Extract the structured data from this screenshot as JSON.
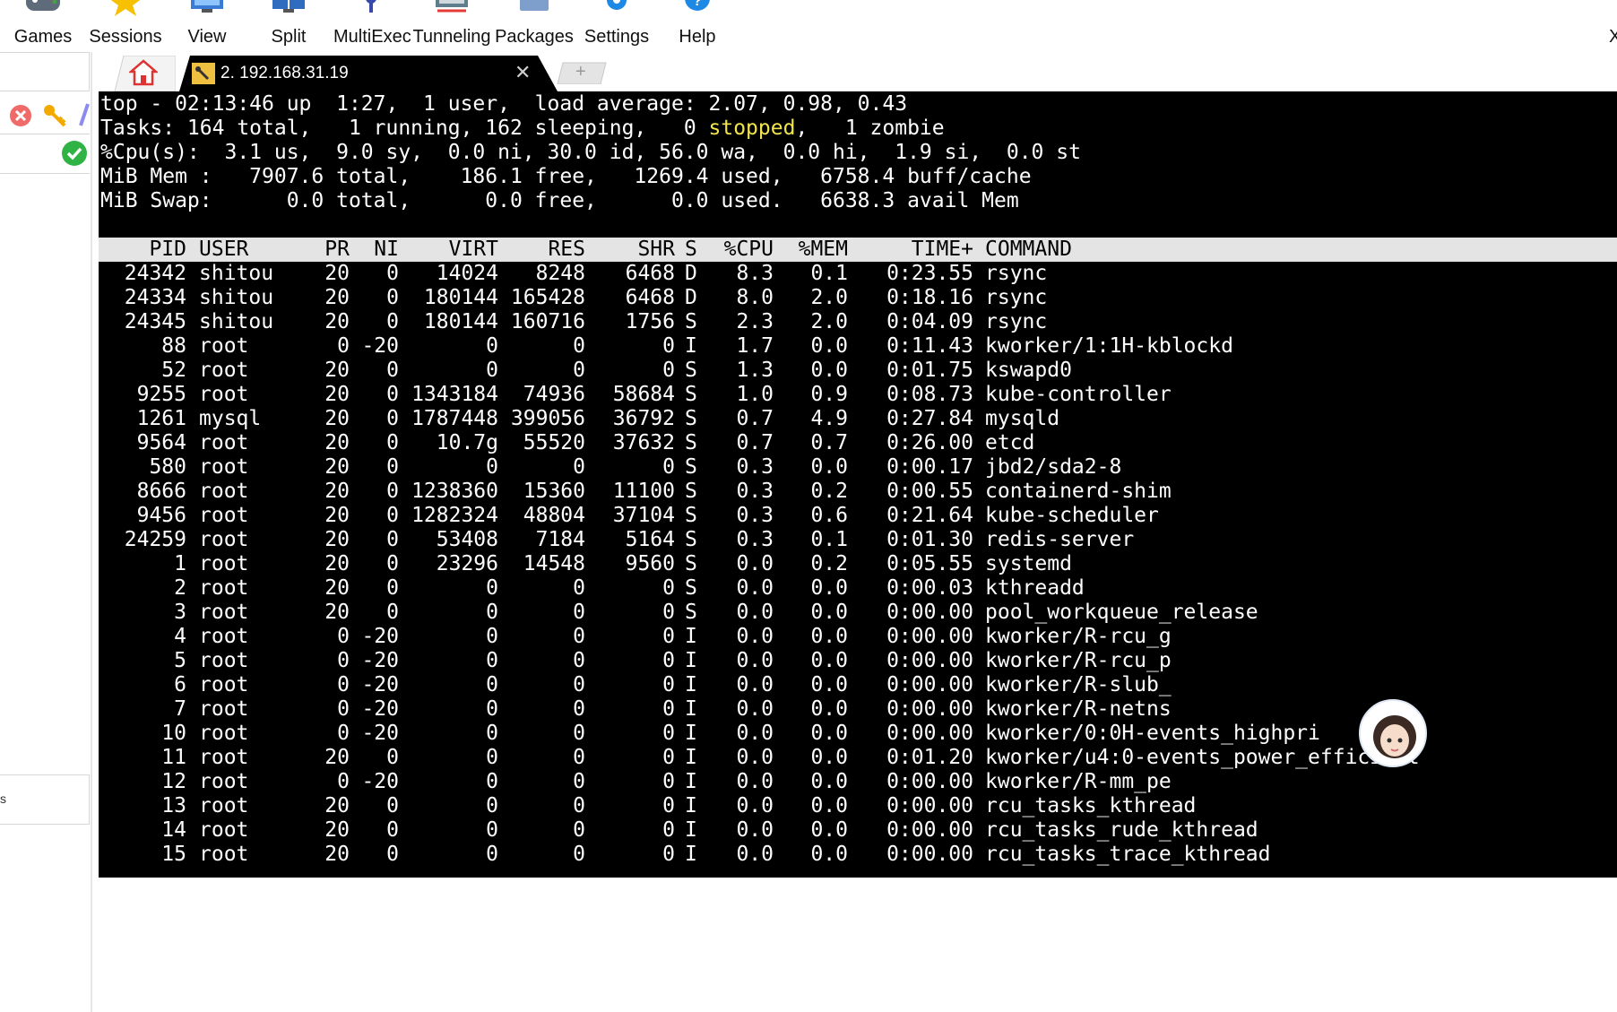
{
  "toolbar": {
    "items": [
      {
        "label": "Games",
        "icon": "games-icon"
      },
      {
        "label": "Sessions",
        "icon": "star-icon"
      },
      {
        "label": "View",
        "icon": "view-icon"
      },
      {
        "label": "Split",
        "icon": "split-icon"
      },
      {
        "label": "MultiExec",
        "icon": "multiexec-icon"
      },
      {
        "label": "Tunneling",
        "icon": "tunneling-icon"
      },
      {
        "label": "Packages",
        "icon": "packages-icon"
      },
      {
        "label": "Settings",
        "icon": "gear-icon"
      },
      {
        "label": "Help",
        "icon": "help-icon"
      }
    ],
    "close_glyph": "X"
  },
  "tabs": {
    "active_title": "2. 192.168.31.19",
    "close_glyph": "✕",
    "new_tab_glyph": "+"
  },
  "sidebar": {
    "bottom_label": "s"
  },
  "terminal": {
    "summary": [
      "top - 02:13:46 up  1:27,  1 user,  load average: 2.07, 0.98, 0.43",
      "%Cpu(s):  3.1 us,  9.0 sy,  0.0 ni, 30.0 id, 56.0 wa,  0.0 hi,  1.9 si,  0.0 st",
      "MiB Mem :   7907.6 total,    186.1 free,   1269.4 used,   6758.4 buff/cache",
      "MiB Swap:      0.0 total,      0.0 free,      0.0 used.   6638.3 avail Mem"
    ],
    "tasks": {
      "prefix": "Tasks: 164 total,   1 running, 162 sleeping,   0 ",
      "stopped": "stopped",
      "suffix": ",   1 zombie"
    },
    "columns": [
      "PID",
      "USER",
      "PR",
      "NI",
      "VIRT",
      "RES",
      "SHR",
      "S",
      "%CPU",
      "%MEM",
      "TIME+",
      "COMMAND"
    ],
    "processes": [
      [
        "24342",
        "shitou",
        "20",
        "0",
        "14024",
        "8248",
        "6468",
        "D",
        "8.3",
        "0.1",
        "0:23.55",
        "rsync"
      ],
      [
        "24334",
        "shitou",
        "20",
        "0",
        "180144",
        "165428",
        "6468",
        "D",
        "8.0",
        "2.0",
        "0:18.16",
        "rsync"
      ],
      [
        "24345",
        "shitou",
        "20",
        "0",
        "180144",
        "160716",
        "1756",
        "S",
        "2.3",
        "2.0",
        "0:04.09",
        "rsync"
      ],
      [
        "88",
        "root",
        "0",
        "-20",
        "0",
        "0",
        "0",
        "I",
        "1.7",
        "0.0",
        "0:11.43",
        "kworker/1:1H-kblockd"
      ],
      [
        "52",
        "root",
        "20",
        "0",
        "0",
        "0",
        "0",
        "S",
        "1.3",
        "0.0",
        "0:01.75",
        "kswapd0"
      ],
      [
        "9255",
        "root",
        "20",
        "0",
        "1343184",
        "74936",
        "58684",
        "S",
        "1.0",
        "0.9",
        "0:08.73",
        "kube-controller"
      ],
      [
        "1261",
        "mysql",
        "20",
        "0",
        "1787448",
        "399056",
        "36792",
        "S",
        "0.7",
        "4.9",
        "0:27.84",
        "mysqld"
      ],
      [
        "9564",
        "root",
        "20",
        "0",
        "10.7g",
        "55520",
        "37632",
        "S",
        "0.7",
        "0.7",
        "0:26.00",
        "etcd"
      ],
      [
        "580",
        "root",
        "20",
        "0",
        "0",
        "0",
        "0",
        "S",
        "0.3",
        "0.0",
        "0:00.17",
        "jbd2/sda2-8"
      ],
      [
        "8666",
        "root",
        "20",
        "0",
        "1238360",
        "15360",
        "11100",
        "S",
        "0.3",
        "0.2",
        "0:00.55",
        "containerd-shim"
      ],
      [
        "9456",
        "root",
        "20",
        "0",
        "1282324",
        "48804",
        "37104",
        "S",
        "0.3",
        "0.6",
        "0:21.64",
        "kube-scheduler"
      ],
      [
        "24259",
        "root",
        "20",
        "0",
        "53408",
        "7184",
        "5164",
        "S",
        "0.3",
        "0.1",
        "0:01.30",
        "redis-server"
      ],
      [
        "1",
        "root",
        "20",
        "0",
        "23296",
        "14548",
        "9560",
        "S",
        "0.0",
        "0.2",
        "0:05.55",
        "systemd"
      ],
      [
        "2",
        "root",
        "20",
        "0",
        "0",
        "0",
        "0",
        "S",
        "0.0",
        "0.0",
        "0:00.03",
        "kthreadd"
      ],
      [
        "3",
        "root",
        "20",
        "0",
        "0",
        "0",
        "0",
        "S",
        "0.0",
        "0.0",
        "0:00.00",
        "pool_workqueue_release"
      ],
      [
        "4",
        "root",
        "0",
        "-20",
        "0",
        "0",
        "0",
        "I",
        "0.0",
        "0.0",
        "0:00.00",
        "kworker/R-rcu_g"
      ],
      [
        "5",
        "root",
        "0",
        "-20",
        "0",
        "0",
        "0",
        "I",
        "0.0",
        "0.0",
        "0:00.00",
        "kworker/R-rcu_p"
      ],
      [
        "6",
        "root",
        "0",
        "-20",
        "0",
        "0",
        "0",
        "I",
        "0.0",
        "0.0",
        "0:00.00",
        "kworker/R-slub_"
      ],
      [
        "7",
        "root",
        "0",
        "-20",
        "0",
        "0",
        "0",
        "I",
        "0.0",
        "0.0",
        "0:00.00",
        "kworker/R-netns"
      ],
      [
        "10",
        "root",
        "0",
        "-20",
        "0",
        "0",
        "0",
        "I",
        "0.0",
        "0.0",
        "0:00.00",
        "kworker/0:0H-events_highpri"
      ],
      [
        "11",
        "root",
        "20",
        "0",
        "0",
        "0",
        "0",
        "I",
        "0.0",
        "0.0",
        "0:01.20",
        "kworker/u4:0-events_power_efficient"
      ],
      [
        "12",
        "root",
        "0",
        "-20",
        "0",
        "0",
        "0",
        "I",
        "0.0",
        "0.0",
        "0:00.00",
        "kworker/R-mm_pe"
      ],
      [
        "13",
        "root",
        "20",
        "0",
        "0",
        "0",
        "0",
        "I",
        "0.0",
        "0.0",
        "0:00.00",
        "rcu_tasks_kthread"
      ],
      [
        "14",
        "root",
        "20",
        "0",
        "0",
        "0",
        "0",
        "I",
        "0.0",
        "0.0",
        "0:00.00",
        "rcu_tasks_rude_kthread"
      ],
      [
        "15",
        "root",
        "20",
        "0",
        "0",
        "0",
        "0",
        "I",
        "0.0",
        "0.0",
        "0:00.00",
        "rcu_tasks_trace_kthread"
      ]
    ]
  },
  "colors": {
    "terminal_bg": "#000000",
    "terminal_fg": "#ffffff",
    "header_bg": "#e4e4e4",
    "stopped_highlight": "#f2e44b",
    "accent_blue": "#1e88e5"
  }
}
